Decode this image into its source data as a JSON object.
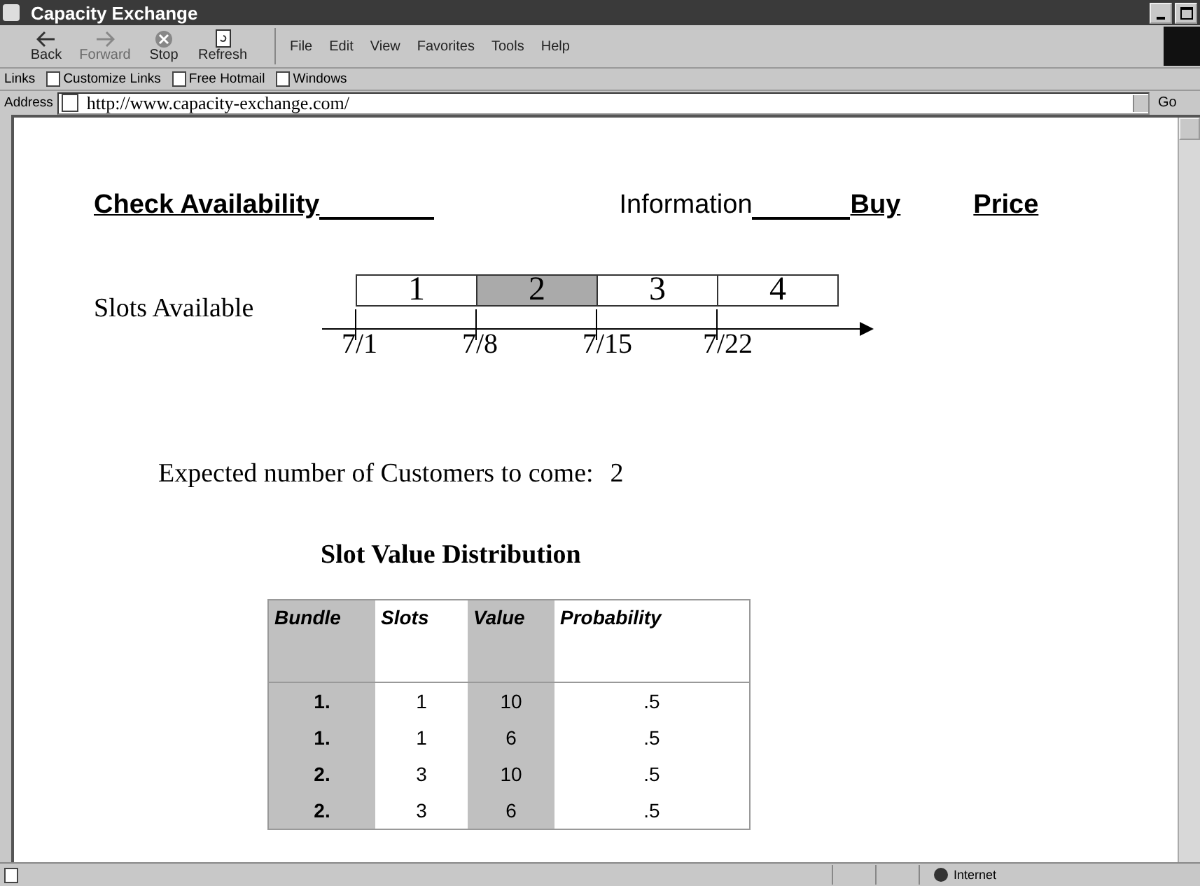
{
  "window": {
    "title": "Capacity Exchange"
  },
  "toolbar": [
    {
      "label": "Back",
      "kind": "back",
      "disabled": false
    },
    {
      "label": "Forward",
      "kind": "forward",
      "disabled": true
    },
    {
      "label": "Stop",
      "kind": "stop",
      "disabled": false
    },
    {
      "label": "Refresh",
      "kind": "refresh",
      "disabled": false
    }
  ],
  "menu": [
    "File",
    "Edit",
    "View",
    "Favorites",
    "Tools",
    "Help"
  ],
  "links": {
    "label": "Links",
    "items": [
      "Customize Links",
      "Free Hotmail",
      "Windows"
    ]
  },
  "address": {
    "label": "Address",
    "value": "http://www.capacity-exchange.com/",
    "go": "Go"
  },
  "nav": [
    {
      "label": "Check Availability",
      "underlined": true
    },
    {
      "label": "Information",
      "underlined": false
    },
    {
      "label": "Buy",
      "underlined": true
    },
    {
      "label": "Price",
      "underlined": true
    }
  ],
  "slots_label": "Slots Available",
  "slots": [
    {
      "label": "1",
      "selected": false
    },
    {
      "label": "2",
      "selected": true
    },
    {
      "label": "3",
      "selected": false
    },
    {
      "label": "4",
      "selected": false
    }
  ],
  "dates": [
    "7/1",
    "7/8",
    "7/15",
    "7/22"
  ],
  "expected": {
    "label": "Expected number of Customers to come:",
    "value": "2"
  },
  "table": {
    "title": "Slot Value Distribution",
    "columns": [
      {
        "label": "Bundle",
        "shaded": true
      },
      {
        "label": "Slots",
        "shaded": false
      },
      {
        "label": "Value",
        "shaded": true
      },
      {
        "label": "Probability",
        "shaded": false
      }
    ],
    "rows": [
      [
        "1.",
        "1",
        "10",
        ".5"
      ],
      [
        "1.",
        "1",
        "6",
        ".5"
      ],
      [
        "2.",
        "3",
        "10",
        ".5"
      ],
      [
        "2.",
        "3",
        "6",
        ".5"
      ]
    ]
  },
  "status_bar": {
    "zone": "Internet"
  }
}
